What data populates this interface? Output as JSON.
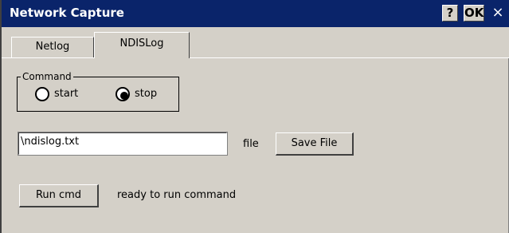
{
  "window": {
    "title": "Network Capture",
    "help_button": "?",
    "ok_button": "OK",
    "close_button": "×"
  },
  "tabs": [
    {
      "label": "Netlog",
      "selected": false
    },
    {
      "label": "NDISLog",
      "selected": true
    }
  ],
  "command_group": {
    "label": "Command",
    "options": [
      {
        "label": "start",
        "checked": false
      },
      {
        "label": "stop",
        "checked": true
      }
    ]
  },
  "file": {
    "value": "\\ndislog.txt",
    "label": "file",
    "save_button": "Save File"
  },
  "run": {
    "button": "Run cmd",
    "status": "ready to run command"
  },
  "colors": {
    "titlebar": "#0a246a",
    "face": "#d4d0c8"
  }
}
